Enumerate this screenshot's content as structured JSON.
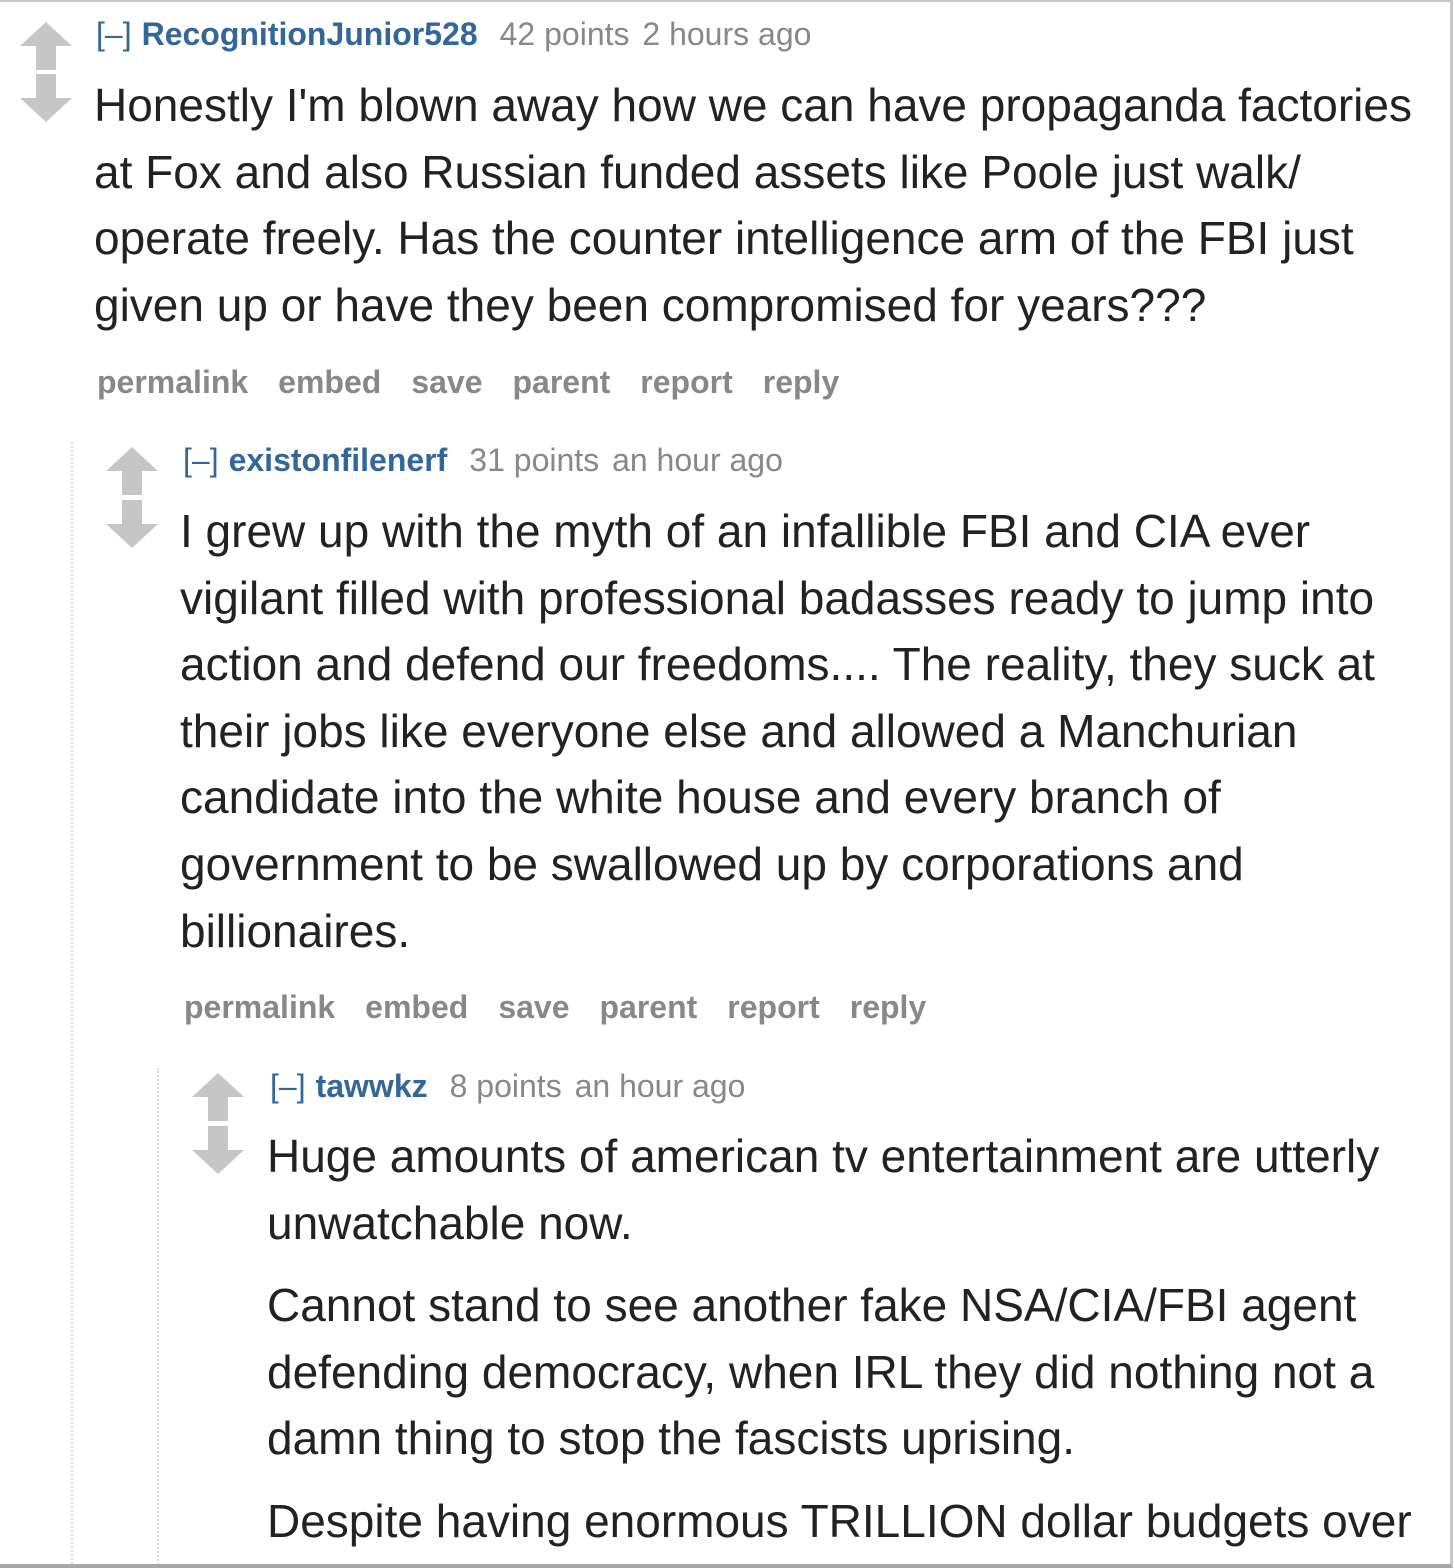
{
  "comments": [
    {
      "expand_label": "[–]",
      "author": "RecognitionJunior528",
      "points": "42 points",
      "age": "2 hours ago",
      "paragraphs": [
        "Honestly I'm blown away how we can have propaganda factories at Fox and also Russian funded assets like Poole just walk/ operate freely. Has the counter intelligence arm of the FBI just given up or have they been compromised for years???"
      ],
      "buttons": [
        "permalink",
        "embed",
        "save",
        "parent",
        "report",
        "reply"
      ]
    },
    {
      "expand_label": "[–]",
      "author": "existonfilenerf",
      "points": "31 points",
      "age": "an hour ago",
      "paragraphs": [
        "I grew up with the myth of an infallible FBI and CIA ever vigilant filled with professional badasses ready to jump into action and defend our freedoms.... The reality, they suck at their jobs like everyone else and allowed a Manchurian candidate into the white house and every branch of government to be swallowed up by corporations and billionaires."
      ],
      "buttons": [
        "permalink",
        "embed",
        "save",
        "parent",
        "report",
        "reply"
      ]
    },
    {
      "expand_label": "[–]",
      "author": "tawwkz",
      "points": "8 points",
      "age": "an hour ago",
      "paragraphs": [
        "Huge amounts of american tv entertainment are utterly unwatchable now.",
        "Cannot stand to see another fake NSA/CIA/FBI agent defending democracy, when IRL they did nothing not a damn thing to stop the fascists uprising.",
        "Despite having enormous TRILLION dollar budgets over"
      ]
    }
  ],
  "icons": {
    "upvote": "upvote-arrow-icon",
    "downvote": "downvote-arrow-icon"
  },
  "colors": {
    "author_link": "#336699",
    "meta_text": "#888888",
    "body_text": "#222222",
    "arrow": "#c6c6c6"
  }
}
